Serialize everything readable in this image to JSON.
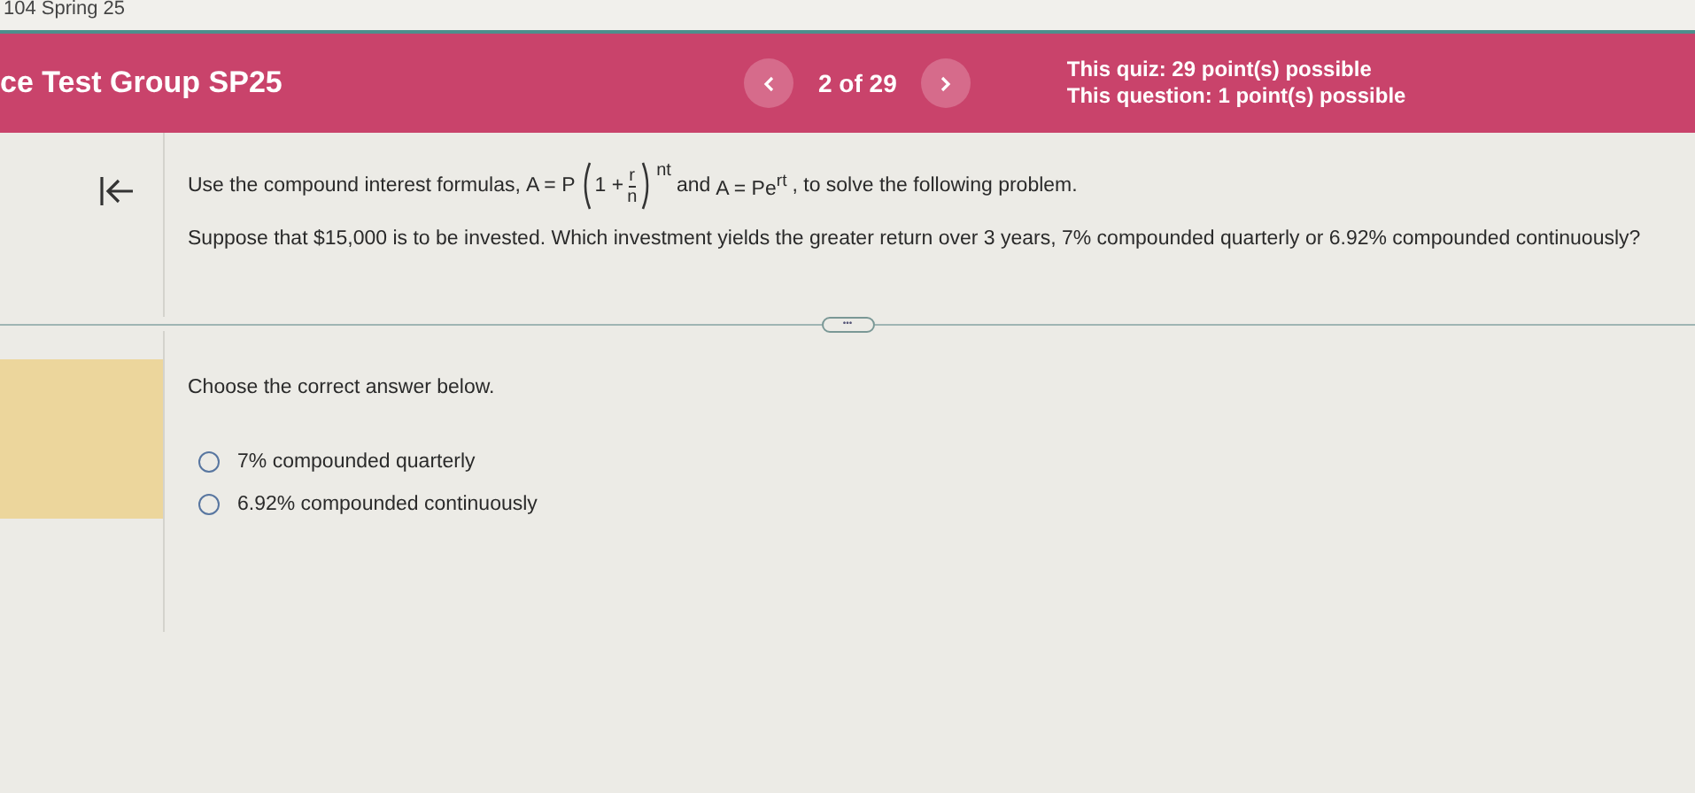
{
  "browser_tab": {
    "title": "104 Spring 25"
  },
  "header": {
    "title": "ce Test Group SP25",
    "position": "2 of 29",
    "quiz_points": "This quiz: 29 point(s) possible",
    "question_points": "This question: 1 point(s) possible"
  },
  "question": {
    "instruction_before": "Use the compound interest formulas,",
    "formula_1": {
      "lhs": "A = P",
      "inner": "1 +",
      "numerator": "r",
      "denominator": "n",
      "exponent": "nt"
    },
    "instruction_middle": "and",
    "formula_2": "A = Pe$^{rt}$",
    "instruction_after": ", to solve the following problem.",
    "problem": "Suppose that $15,000 is to be invested. Which investment yields the greater return over 3 years, 7% compounded quarterly or 6.92% compounded continuously?",
    "divider_button": "•••"
  },
  "answer": {
    "prompt": "Choose the correct answer below.",
    "options": [
      {
        "label": "7% compounded quarterly",
        "selected": false
      },
      {
        "label": "6.92% compounded continuously",
        "selected": false
      }
    ]
  }
}
